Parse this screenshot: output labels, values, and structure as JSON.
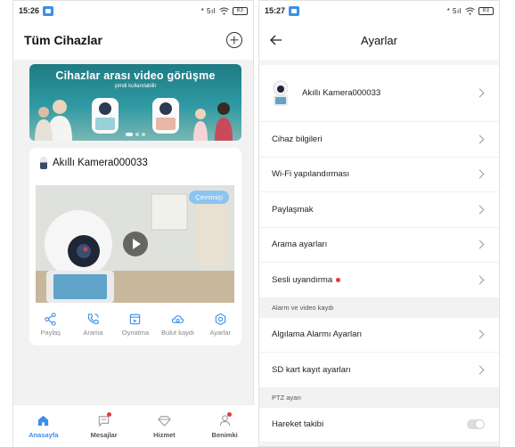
{
  "left": {
    "status": {
      "time": "15:26",
      "signal": "* 5ıl",
      "battery": "83"
    },
    "title": "Tüm Cihazlar",
    "banner": {
      "title": "Cihazlar arası video görüşme",
      "subtitle": "şimdi kullanılabilir"
    },
    "device": {
      "name": "Akıllı Kamera000033",
      "badge": "Çevrimiçi"
    },
    "actions": [
      {
        "label": "Paylaş",
        "icon": "share-icon"
      },
      {
        "label": "Arama",
        "icon": "phone-icon"
      },
      {
        "label": "Oynatma",
        "icon": "playback-icon"
      },
      {
        "label": "Bulut kaydı",
        "icon": "cloud-icon"
      },
      {
        "label": "Ayarlar",
        "icon": "settings-icon"
      }
    ],
    "nav": [
      {
        "label": "Anasayfa",
        "icon": "home-icon",
        "active": true
      },
      {
        "label": "Mesajlar",
        "icon": "message-icon"
      },
      {
        "label": "Hizmet",
        "icon": "diamond-icon"
      },
      {
        "label": "Benimki",
        "icon": "profile-icon"
      }
    ]
  },
  "right": {
    "status": {
      "time": "15:27",
      "signal": "* 5ıl",
      "battery": "83"
    },
    "title": "Ayarlar",
    "device_name": "Akıllı Kamera000033",
    "rows_group1": [
      {
        "label": "Cihaz bilgileri"
      },
      {
        "label": "Wi-Fi yapılandırması"
      },
      {
        "label": "Paylaşmak"
      },
      {
        "label": "Arama ayarları"
      },
      {
        "label": "Sesli uyandırma"
      }
    ],
    "section_alarm": "Alarm ve video kaydı",
    "rows_group2": [
      {
        "label": "Algılama Alarmı Ayarları"
      },
      {
        "label": "SD kart kayıt ayarları"
      }
    ],
    "section_ptz": "PTZ ayarı",
    "motion_tracking": {
      "label": "Hareket takibi",
      "enabled": false
    }
  },
  "colors": {
    "accent": "#3d8fe8",
    "badge": "#8cc4f2",
    "alert": "#e23b3b",
    "banner": "#2f9aa3"
  }
}
